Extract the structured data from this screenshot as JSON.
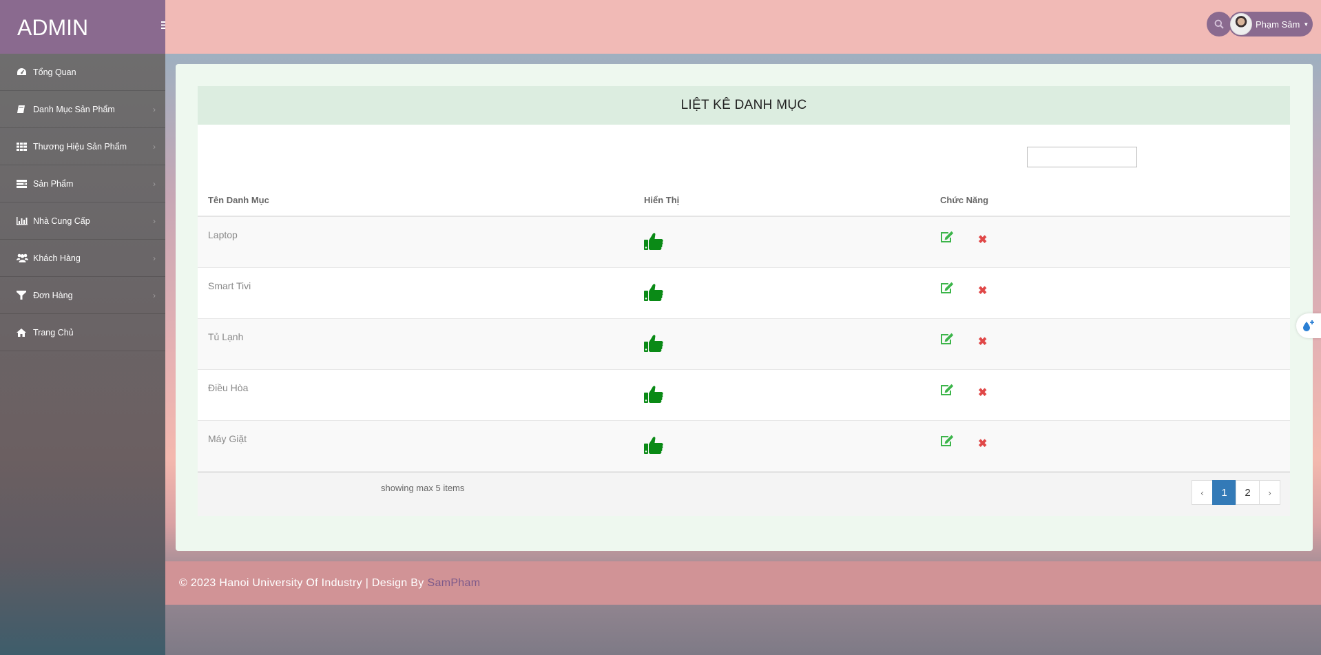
{
  "brand": "ADMIN",
  "sidebar": {
    "items": [
      {
        "label": "Tổng Quan",
        "icon": "dashboard-icon"
      },
      {
        "label": "Danh Mục Sản Phẩm",
        "icon": "book-icon"
      },
      {
        "label": "Thương Hiệu Sản Phẩm",
        "icon": "grid-icon"
      },
      {
        "label": "Sản Phẩm",
        "icon": "tasks-icon"
      },
      {
        "label": "Nhà Cung Cấp",
        "icon": "bar-chart-icon"
      },
      {
        "label": "Khách Hàng",
        "icon": "users-icon"
      },
      {
        "label": "Đơn Hàng",
        "icon": "filter-icon"
      },
      {
        "label": "Trang Chủ",
        "icon": "home-icon"
      }
    ]
  },
  "header": {
    "user_name": "Phạm Sâm"
  },
  "table": {
    "title": "LIỆT KÊ DANH MỤC",
    "search_value": "",
    "columns": [
      "Tên Danh Mục",
      "Hiển Thị",
      "Chức Năng"
    ],
    "rows": [
      {
        "name": "Laptop",
        "visible": true
      },
      {
        "name": "Smart Tivi",
        "visible": true
      },
      {
        "name": "Tủ Lạnh",
        "visible": true
      },
      {
        "name": "Điều Hòa",
        "visible": true
      },
      {
        "name": "Máy Giặt",
        "visible": true
      }
    ],
    "showing_text": "showing max 5 items",
    "pagination": {
      "prev": "‹",
      "pages": [
        "1",
        "2"
      ],
      "active": "1",
      "next": "›"
    }
  },
  "footer": {
    "text": "© 2023 Hanoi University Of Industry | Design By",
    "author": "SamPham"
  },
  "colors": {
    "accent": "#8a6a8f",
    "thumb_green": "#0a8a16",
    "edit_green": "#3cb54a",
    "delete_red": "#e04848",
    "active_page": "#337ab7"
  }
}
